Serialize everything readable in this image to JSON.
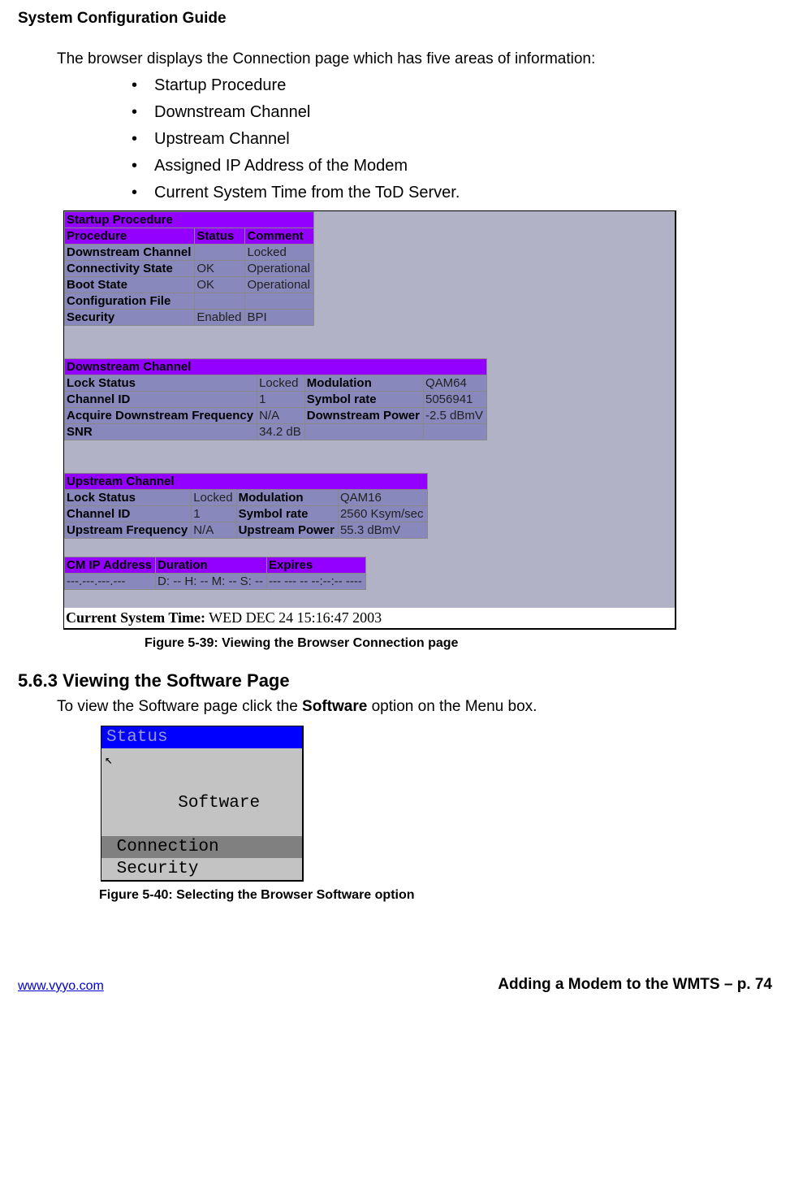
{
  "header": "System Configuration Guide",
  "intro": "The browser displays the Connection page which has five areas of information:",
  "bullets": [
    "Startup Procedure",
    "Downstream Channel",
    "Upstream Channel",
    "Assigned IP Address of the Modem",
    "Current System Time from the ToD Server."
  ],
  "startup": {
    "title": "Startup Procedure",
    "cols": [
      "Procedure",
      "Status",
      "Comment"
    ],
    "rows": [
      [
        "Downstream Channel",
        "",
        "Locked"
      ],
      [
        "Connectivity State",
        "OK",
        "Operational"
      ],
      [
        "Boot State",
        "OK",
        "Operational"
      ],
      [
        "Configuration File",
        "",
        ""
      ],
      [
        "Security",
        "Enabled",
        "BPI"
      ]
    ]
  },
  "downstream": {
    "title": "Downstream Channel",
    "rows": [
      [
        "Lock Status",
        "Locked",
        "Modulation",
        "QAM64"
      ],
      [
        "Channel ID",
        "1",
        "Symbol rate",
        "5056941"
      ],
      [
        "Acquire Downstream Frequency",
        "N/A",
        "Downstream Power",
        "-2.5 dBmV"
      ],
      [
        "SNR",
        "34.2 dB",
        "",
        ""
      ]
    ]
  },
  "upstream": {
    "title": "Upstream Channel",
    "rows": [
      [
        "Lock Status",
        "Locked",
        "Modulation",
        "QAM16"
      ],
      [
        "Channel ID",
        "1",
        "Symbol rate",
        "2560 Ksym/sec"
      ],
      [
        "Upstream Frequency",
        "N/A",
        "Upstream Power",
        "55.3 dBmV"
      ]
    ]
  },
  "ip": {
    "cols": [
      "CM IP Address",
      "Duration",
      "Expires"
    ],
    "row": [
      "---.---.---.---",
      "D: -- H: -- M: -- S: --",
      "--- --- -- --:--:-- ----"
    ]
  },
  "systemTime": {
    "label": "Current System Time:",
    "value": " WED DEC 24 15:16:47 2003"
  },
  "figCaption1": "Figure 5-39:  Viewing the Browser Connection page",
  "section_num": "5.6.3 ",
  "section_title": "Viewing the Software Page",
  "section_body_pre": "To view the Software page click the ",
  "section_body_bold": "Software",
  "section_body_post": " option on the Menu box.",
  "menu": {
    "status": "Status",
    "software": " Software",
    "connection": " Connection",
    "security": " Security"
  },
  "figCaption2": "Figure 5-40:  Selecting the Browser Software option",
  "footer": {
    "left": "www.vyyo.com",
    "right": "Adding a Modem to the WMTS – p. 74"
  }
}
